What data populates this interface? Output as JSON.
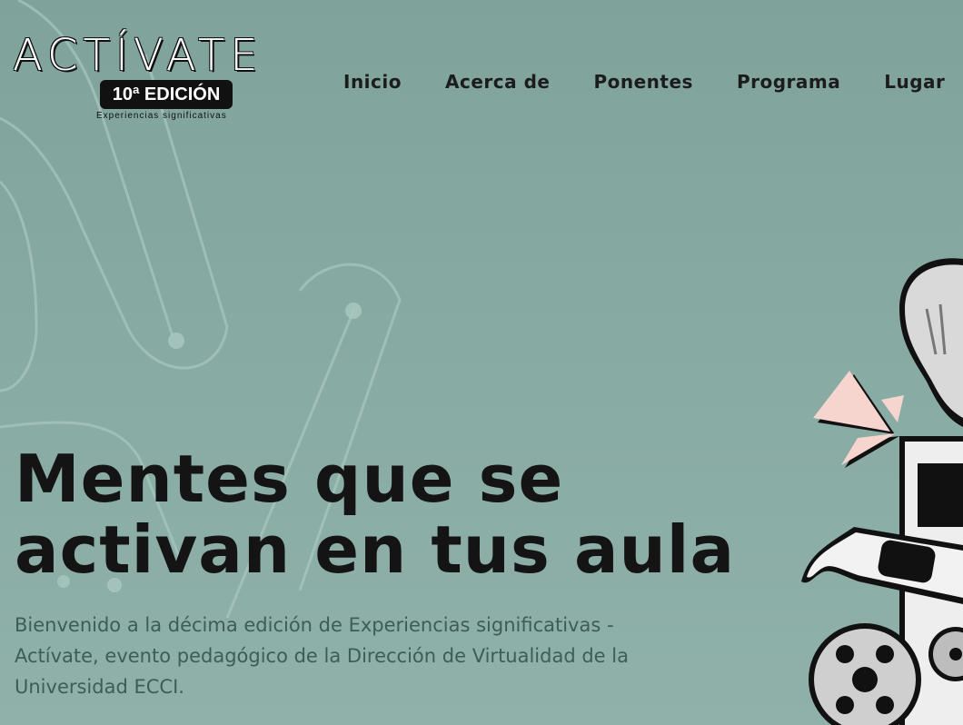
{
  "logo": {
    "wordmark": "ACTÍVATE",
    "edition": "10ª EDICIÓN",
    "tagline": "Experiencias significativas"
  },
  "nav": {
    "items": [
      "Inicio",
      "Acerca de",
      "Ponentes",
      "Programa",
      "Lugar"
    ]
  },
  "hero": {
    "title_line1": "Mentes que se",
    "title_line2": "activan en tus aula",
    "description": "Bienvenido a la décima edición de Experiencias significativas - Actívate, evento pedagógico de la Dirección de Virtualidad de la Universidad ECCI."
  },
  "colors": {
    "background": "#87aaa2",
    "text_dark": "#141414",
    "accent_pink": "#f6d5cf"
  },
  "icons": [
    "lightbulb-icon",
    "glasses-icon",
    "gear-icon"
  ]
}
